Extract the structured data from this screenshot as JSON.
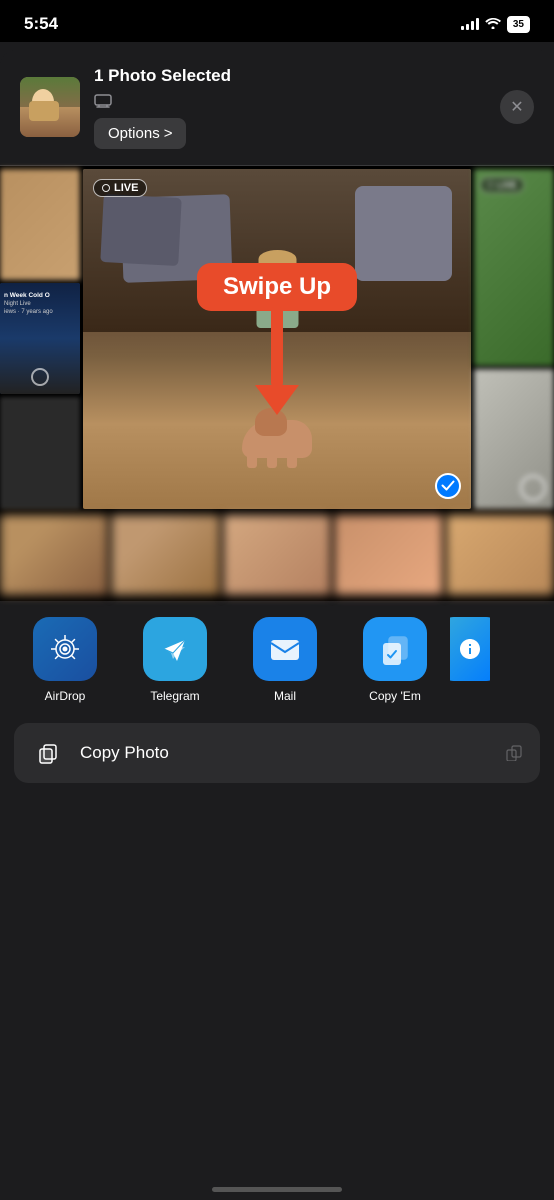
{
  "statusBar": {
    "time": "5:54",
    "battery": "35"
  },
  "shareHeader": {
    "title": "1 Photo Selected",
    "optionsLabel": "Options",
    "optionsArrow": ">",
    "closeLabel": "×"
  },
  "liveBadge": "LIVE",
  "swipeUp": {
    "label": "Swipe Up"
  },
  "appRow": {
    "apps": [
      {
        "id": "airdrop",
        "label": "AirDrop"
      },
      {
        "id": "telegram",
        "label": "Telegram"
      },
      {
        "id": "mail",
        "label": "Mail"
      },
      {
        "id": "copyem",
        "label": "Copy 'Em"
      }
    ]
  },
  "actionRows": [
    {
      "id": "copy-photo",
      "label": "Copy Photo",
      "iconType": "copy"
    }
  ],
  "colors": {
    "red": "#e84b2a",
    "blue": "#007aff",
    "background": "#1c1c1e"
  }
}
